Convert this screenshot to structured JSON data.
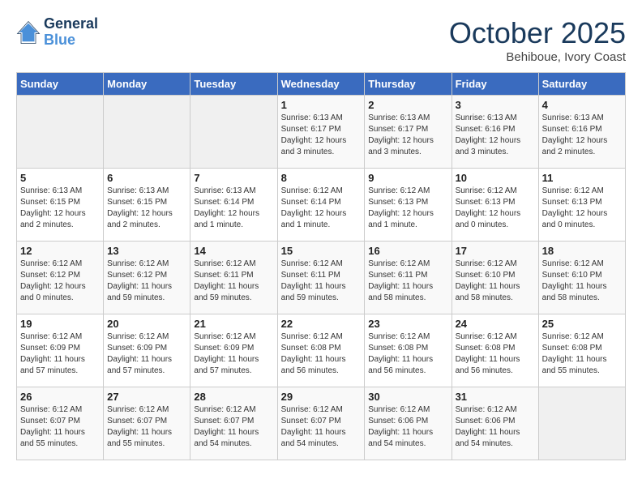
{
  "header": {
    "logo_line1": "General",
    "logo_line2": "Blue",
    "month": "October 2025",
    "location": "Behiboue, Ivory Coast"
  },
  "days_of_week": [
    "Sunday",
    "Monday",
    "Tuesday",
    "Wednesday",
    "Thursday",
    "Friday",
    "Saturday"
  ],
  "weeks": [
    [
      {
        "day": "",
        "info": ""
      },
      {
        "day": "",
        "info": ""
      },
      {
        "day": "",
        "info": ""
      },
      {
        "day": "1",
        "info": "Sunrise: 6:13 AM\nSunset: 6:17 PM\nDaylight: 12 hours\nand 3 minutes."
      },
      {
        "day": "2",
        "info": "Sunrise: 6:13 AM\nSunset: 6:17 PM\nDaylight: 12 hours\nand 3 minutes."
      },
      {
        "day": "3",
        "info": "Sunrise: 6:13 AM\nSunset: 6:16 PM\nDaylight: 12 hours\nand 3 minutes."
      },
      {
        "day": "4",
        "info": "Sunrise: 6:13 AM\nSunset: 6:16 PM\nDaylight: 12 hours\nand 2 minutes."
      }
    ],
    [
      {
        "day": "5",
        "info": "Sunrise: 6:13 AM\nSunset: 6:15 PM\nDaylight: 12 hours\nand 2 minutes."
      },
      {
        "day": "6",
        "info": "Sunrise: 6:13 AM\nSunset: 6:15 PM\nDaylight: 12 hours\nand 2 minutes."
      },
      {
        "day": "7",
        "info": "Sunrise: 6:13 AM\nSunset: 6:14 PM\nDaylight: 12 hours\nand 1 minute."
      },
      {
        "day": "8",
        "info": "Sunrise: 6:12 AM\nSunset: 6:14 PM\nDaylight: 12 hours\nand 1 minute."
      },
      {
        "day": "9",
        "info": "Sunrise: 6:12 AM\nSunset: 6:13 PM\nDaylight: 12 hours\nand 1 minute."
      },
      {
        "day": "10",
        "info": "Sunrise: 6:12 AM\nSunset: 6:13 PM\nDaylight: 12 hours\nand 0 minutes."
      },
      {
        "day": "11",
        "info": "Sunrise: 6:12 AM\nSunset: 6:13 PM\nDaylight: 12 hours\nand 0 minutes."
      }
    ],
    [
      {
        "day": "12",
        "info": "Sunrise: 6:12 AM\nSunset: 6:12 PM\nDaylight: 12 hours\nand 0 minutes."
      },
      {
        "day": "13",
        "info": "Sunrise: 6:12 AM\nSunset: 6:12 PM\nDaylight: 11 hours\nand 59 minutes."
      },
      {
        "day": "14",
        "info": "Sunrise: 6:12 AM\nSunset: 6:11 PM\nDaylight: 11 hours\nand 59 minutes."
      },
      {
        "day": "15",
        "info": "Sunrise: 6:12 AM\nSunset: 6:11 PM\nDaylight: 11 hours\nand 59 minutes."
      },
      {
        "day": "16",
        "info": "Sunrise: 6:12 AM\nSunset: 6:11 PM\nDaylight: 11 hours\nand 58 minutes."
      },
      {
        "day": "17",
        "info": "Sunrise: 6:12 AM\nSunset: 6:10 PM\nDaylight: 11 hours\nand 58 minutes."
      },
      {
        "day": "18",
        "info": "Sunrise: 6:12 AM\nSunset: 6:10 PM\nDaylight: 11 hours\nand 58 minutes."
      }
    ],
    [
      {
        "day": "19",
        "info": "Sunrise: 6:12 AM\nSunset: 6:09 PM\nDaylight: 11 hours\nand 57 minutes."
      },
      {
        "day": "20",
        "info": "Sunrise: 6:12 AM\nSunset: 6:09 PM\nDaylight: 11 hours\nand 57 minutes."
      },
      {
        "day": "21",
        "info": "Sunrise: 6:12 AM\nSunset: 6:09 PM\nDaylight: 11 hours\nand 57 minutes."
      },
      {
        "day": "22",
        "info": "Sunrise: 6:12 AM\nSunset: 6:08 PM\nDaylight: 11 hours\nand 56 minutes."
      },
      {
        "day": "23",
        "info": "Sunrise: 6:12 AM\nSunset: 6:08 PM\nDaylight: 11 hours\nand 56 minutes."
      },
      {
        "day": "24",
        "info": "Sunrise: 6:12 AM\nSunset: 6:08 PM\nDaylight: 11 hours\nand 56 minutes."
      },
      {
        "day": "25",
        "info": "Sunrise: 6:12 AM\nSunset: 6:08 PM\nDaylight: 11 hours\nand 55 minutes."
      }
    ],
    [
      {
        "day": "26",
        "info": "Sunrise: 6:12 AM\nSunset: 6:07 PM\nDaylight: 11 hours\nand 55 minutes."
      },
      {
        "day": "27",
        "info": "Sunrise: 6:12 AM\nSunset: 6:07 PM\nDaylight: 11 hours\nand 55 minutes."
      },
      {
        "day": "28",
        "info": "Sunrise: 6:12 AM\nSunset: 6:07 PM\nDaylight: 11 hours\nand 54 minutes."
      },
      {
        "day": "29",
        "info": "Sunrise: 6:12 AM\nSunset: 6:07 PM\nDaylight: 11 hours\nand 54 minutes."
      },
      {
        "day": "30",
        "info": "Sunrise: 6:12 AM\nSunset: 6:06 PM\nDaylight: 11 hours\nand 54 minutes."
      },
      {
        "day": "31",
        "info": "Sunrise: 6:12 AM\nSunset: 6:06 PM\nDaylight: 11 hours\nand 54 minutes."
      },
      {
        "day": "",
        "info": ""
      }
    ]
  ]
}
